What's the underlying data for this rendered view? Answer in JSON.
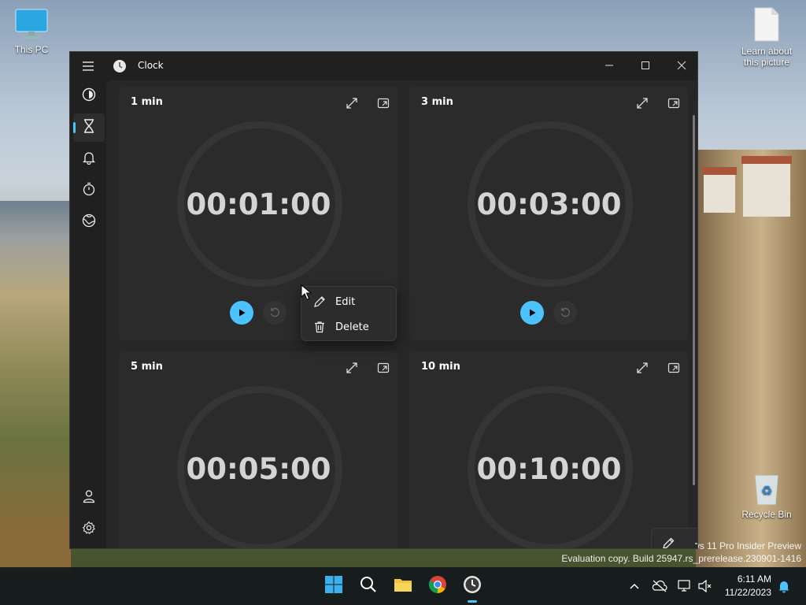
{
  "desktop": {
    "icons": [
      {
        "label": "This PC"
      },
      {
        "label": "Learn about this picture"
      },
      {
        "label": "Recycle Bin"
      }
    ],
    "watermark_line1": "ws 11 Pro Insider Preview",
    "watermark_line2": "Evaluation copy. Build 25947.rs_prerelease.230901-1416"
  },
  "window": {
    "title": "Clock",
    "controls": {
      "minimize": "—",
      "maximize": "▢",
      "close": "✕"
    }
  },
  "nav": {
    "items": [
      {
        "name": "focus-sessions",
        "icon": "focus-icon"
      },
      {
        "name": "timer",
        "icon": "hourglass-icon",
        "active": true
      },
      {
        "name": "alarm",
        "icon": "bell-icon"
      },
      {
        "name": "stopwatch",
        "icon": "stopwatch-icon"
      },
      {
        "name": "world-clock",
        "icon": "globe-icon"
      }
    ],
    "bottom": [
      {
        "name": "account",
        "icon": "person-icon"
      },
      {
        "name": "settings",
        "icon": "gear-icon"
      }
    ]
  },
  "timers": [
    {
      "name": "1 min",
      "time": "00:01:00"
    },
    {
      "name": "3 min",
      "time": "00:03:00"
    },
    {
      "name": "5 min",
      "time": "00:05:00"
    },
    {
      "name": "10 min",
      "time": "00:10:00"
    }
  ],
  "context_menu": {
    "edit": "Edit",
    "delete": "Delete"
  },
  "taskbar": {
    "time": "6:11 AM",
    "date": "11/22/2023"
  },
  "colors": {
    "accent": "#4cc2ff",
    "card": "#2b2b2b",
    "window": "#202020"
  }
}
